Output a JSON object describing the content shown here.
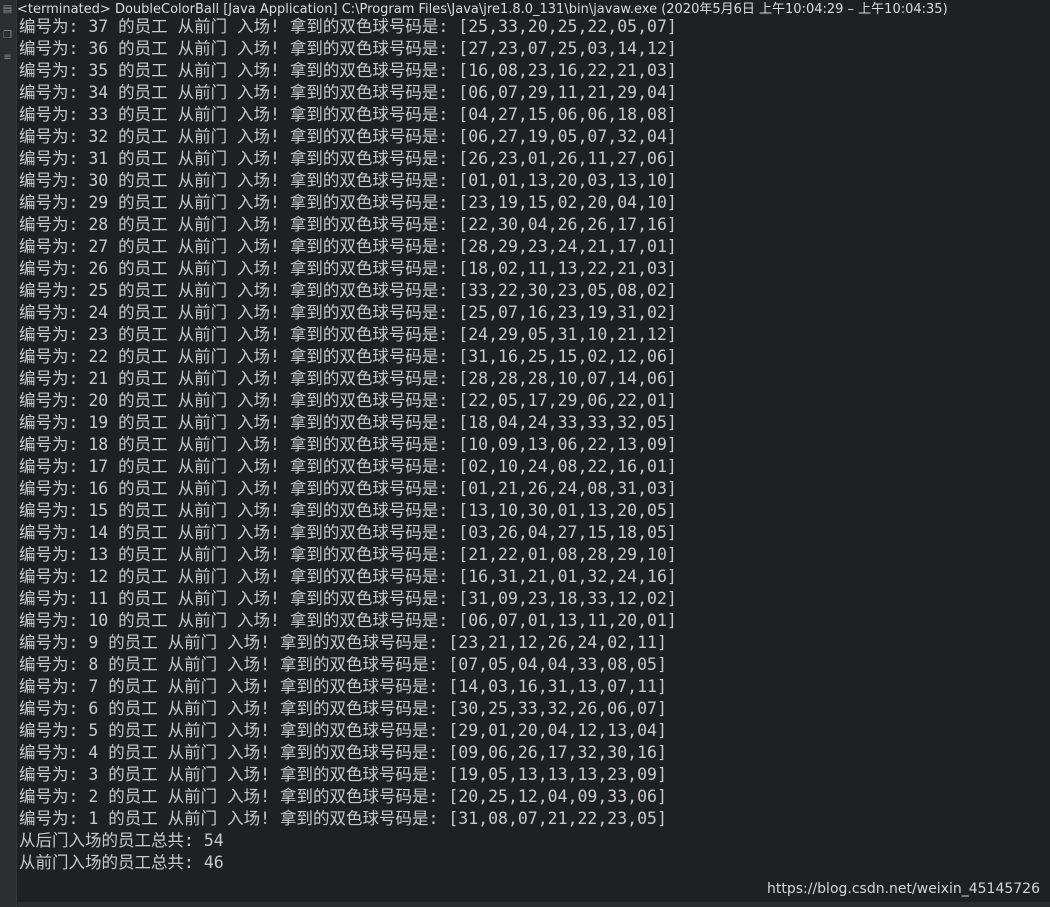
{
  "header": {
    "title": "<terminated> DoubleColorBall [Java Application] C:\\Program Files\\Java\\jre1.8.0_131\\bin\\javaw.exe  (2020年5月6日 上午10:04:29 – 上午10:04:35)"
  },
  "console": {
    "lines": [
      "编号为: 37 的员工 从前门 入场! 拿到的双色球号码是: [25,33,20,25,22,05,07]",
      "编号为: 36 的员工 从前门 入场! 拿到的双色球号码是: [27,23,07,25,03,14,12]",
      "编号为: 35 的员工 从前门 入场! 拿到的双色球号码是: [16,08,23,16,22,21,03]",
      "编号为: 34 的员工 从前门 入场! 拿到的双色球号码是: [06,07,29,11,21,29,04]",
      "编号为: 33 的员工 从前门 入场! 拿到的双色球号码是: [04,27,15,06,06,18,08]",
      "编号为: 32 的员工 从前门 入场! 拿到的双色球号码是: [06,27,19,05,07,32,04]",
      "编号为: 31 的员工 从前门 入场! 拿到的双色球号码是: [26,23,01,26,11,27,06]",
      "编号为: 30 的员工 从前门 入场! 拿到的双色球号码是: [01,01,13,20,03,13,10]",
      "编号为: 29 的员工 从前门 入场! 拿到的双色球号码是: [23,19,15,02,20,04,10]",
      "编号为: 28 的员工 从前门 入场! 拿到的双色球号码是: [22,30,04,26,26,17,16]",
      "编号为: 27 的员工 从前门 入场! 拿到的双色球号码是: [28,29,23,24,21,17,01]",
      "编号为: 26 的员工 从前门 入场! 拿到的双色球号码是: [18,02,11,13,22,21,03]",
      "编号为: 25 的员工 从前门 入场! 拿到的双色球号码是: [33,22,30,23,05,08,02]",
      "编号为: 24 的员工 从前门 入场! 拿到的双色球号码是: [25,07,16,23,19,31,02]",
      "编号为: 23 的员工 从前门 入场! 拿到的双色球号码是: [24,29,05,31,10,21,12]",
      "编号为: 22 的员工 从前门 入场! 拿到的双色球号码是: [31,16,25,15,02,12,06]",
      "编号为: 21 的员工 从前门 入场! 拿到的双色球号码是: [28,28,28,10,07,14,06]",
      "编号为: 20 的员工 从前门 入场! 拿到的双色球号码是: [22,05,17,29,06,22,01]",
      "编号为: 19 的员工 从前门 入场! 拿到的双色球号码是: [18,04,24,33,33,32,05]",
      "编号为: 18 的员工 从前门 入场! 拿到的双色球号码是: [10,09,13,06,22,13,09]",
      "编号为: 17 的员工 从前门 入场! 拿到的双色球号码是: [02,10,24,08,22,16,01]",
      "编号为: 16 的员工 从前门 入场! 拿到的双色球号码是: [01,21,26,24,08,31,03]",
      "编号为: 15 的员工 从前门 入场! 拿到的双色球号码是: [13,10,30,01,13,20,05]",
      "编号为: 14 的员工 从前门 入场! 拿到的双色球号码是: [03,26,04,27,15,18,05]",
      "编号为: 13 的员工 从前门 入场! 拿到的双色球号码是: [21,22,01,08,28,29,10]",
      "编号为: 12 的员工 从前门 入场! 拿到的双色球号码是: [16,31,21,01,32,24,16]",
      "编号为: 11 的员工 从前门 入场! 拿到的双色球号码是: [31,09,23,18,33,12,02]",
      "编号为: 10 的员工 从前门 入场! 拿到的双色球号码是: [06,07,01,13,11,20,01]",
      "编号为: 9 的员工 从前门 入场! 拿到的双色球号码是: [23,21,12,26,24,02,11]",
      "编号为: 8 的员工 从前门 入场! 拿到的双色球号码是: [07,05,04,04,33,08,05]",
      "编号为: 7 的员工 从前门 入场! 拿到的双色球号码是: [14,03,16,31,13,07,11]",
      "编号为: 6 的员工 从前门 入场! 拿到的双色球号码是: [30,25,33,32,26,06,07]",
      "编号为: 5 的员工 从前门 入场! 拿到的双色球号码是: [29,01,20,04,12,13,04]",
      "编号为: 4 的员工 从前门 入场! 拿到的双色球号码是: [09,06,26,17,32,30,16]",
      "编号为: 3 的员工 从前门 入场! 拿到的双色球号码是: [19,05,13,13,13,23,09]",
      "编号为: 2 的员工 从前门 入场! 拿到的双色球号码是: [20,25,12,04,09,33,06]",
      "编号为: 1 的员工 从前门 入场! 拿到的双色球号码是: [31,08,07,21,22,23,05]",
      "从后门入场的员工总共: 54",
      "从前门入场的员工总共: 46"
    ]
  },
  "watermark": "https://blog.csdn.net/weixin_45145726",
  "icons": [
    "terminate-icon",
    "restore-icon",
    "scroll-icon"
  ],
  "colors": {
    "background": "#1e2124",
    "text": "#c9c9c9",
    "header_text": "#dcdcdc"
  }
}
